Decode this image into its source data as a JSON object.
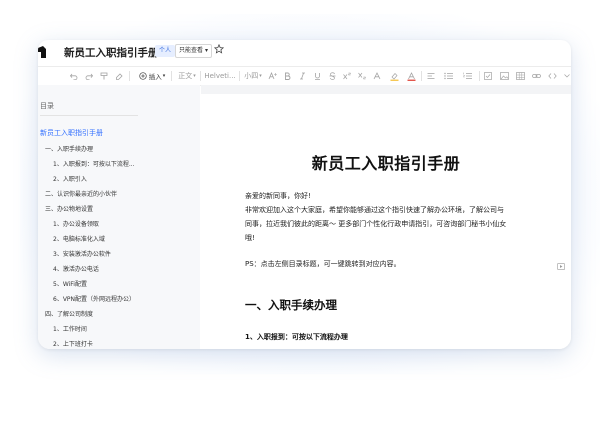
{
  "document": {
    "title": "新员工入职指引手册",
    "tag": "个人",
    "permission": "只能查看",
    "permission_caret": "▾"
  },
  "toolbar": {
    "insert_label": "插入",
    "paragraph_style": "正文",
    "font_name": "Helveti...",
    "font_size": "小四",
    "text_color": "#e0453a",
    "highlight_color": "#f6c344"
  },
  "sidebar": {
    "title": "目录",
    "items": [
      {
        "label": "新员工入职指引手册",
        "level": 0
      },
      {
        "label": "一、入职手续办理",
        "level": 1
      },
      {
        "label": "1、入职报到：可按以下流程...",
        "level": 2
      },
      {
        "label": "2、入职引入",
        "level": 2
      },
      {
        "label": "二、认识你最亲近的小伙伴",
        "level": 1
      },
      {
        "label": "三、办公物地设置",
        "level": 1
      },
      {
        "label": "1、办公设备领取",
        "level": 2
      },
      {
        "label": "2、电脑标准化入域",
        "level": 2
      },
      {
        "label": "3、安装激活办公软件",
        "level": 2
      },
      {
        "label": "4、激活办公电话",
        "level": 2
      },
      {
        "label": "5、WiFi配置",
        "level": 2
      },
      {
        "label": "6、VPN配置（外网远程办公）",
        "level": 2
      },
      {
        "label": "四、了解公司制度",
        "level": 1
      },
      {
        "label": "1、工作时间",
        "level": 2
      },
      {
        "label": "2、上下班打卡",
        "level": 2
      }
    ]
  },
  "content": {
    "heading": "新员工入职指引手册",
    "greeting": "亲爱的新同事，你好!",
    "intro_line1": "非常欢迎加入这个大家庭，希望你能够通过这个指引快速了解办公环境，了解公司与",
    "intro_line2": "同事，拉近我们彼此的距离～ 更多部门个性化行政申请指引，可咨询部门秘书小仙女",
    "intro_line3": "哦!",
    "ps": "PS：点击左侧目录标题，可一键跳转到对应内容。",
    "section1_heading": "一、入职手续办理",
    "section1_sub": "1、入职报到：可按以下流程办理"
  },
  "colors": {
    "accent": "#3370ff",
    "tag_bg": "#e6eeff"
  }
}
